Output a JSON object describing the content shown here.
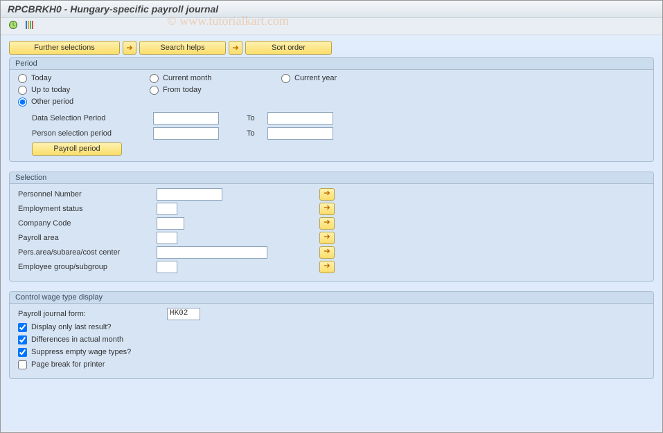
{
  "title": "RPCBRKH0 - Hungary-specific payroll journal",
  "watermark": "© www.tutorialkart.com",
  "toolbar": {
    "further_selections": "Further selections",
    "search_helps": "Search helps",
    "sort_order": "Sort order"
  },
  "period_group": {
    "title": "Period",
    "today": "Today",
    "current_month": "Current month",
    "current_year": "Current year",
    "up_to_today": "Up to today",
    "from_today": "From today",
    "other_period": "Other period",
    "data_sel_period": "Data Selection Period",
    "person_sel_period": "Person selection period",
    "to": "To",
    "payroll_period_btn": "Payroll period"
  },
  "selection_group": {
    "title": "Selection",
    "rows": [
      {
        "label": "Personnel Number",
        "kind": "mid"
      },
      {
        "label": "Employment status",
        "kind": "vshort"
      },
      {
        "label": "Company Code",
        "kind": "short"
      },
      {
        "label": "Payroll area",
        "kind": "vshort"
      },
      {
        "label": "Pers.area/subarea/cost center",
        "kind": "long"
      },
      {
        "label": "Employee group/subgroup",
        "kind": "vshort"
      }
    ]
  },
  "control_group": {
    "title": "Control wage type display",
    "form_label": "Payroll journal form:",
    "form_value": "HK02",
    "checks": [
      {
        "label": "Display only last result?",
        "checked": true
      },
      {
        "label": "Differences in actual month",
        "checked": true
      },
      {
        "label": "Suppress empty wage types?",
        "checked": true
      },
      {
        "label": "Page break for printer",
        "checked": false
      }
    ]
  }
}
